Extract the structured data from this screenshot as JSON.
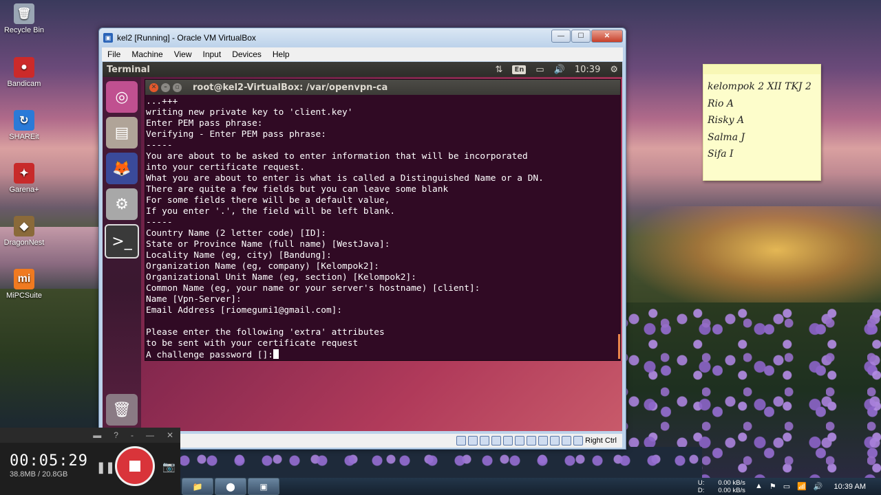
{
  "desktop": {
    "icons": [
      {
        "label": "Recycle Bin",
        "icon": "recycle-bin-icon",
        "glyph": "🗑",
        "color": "#9aa6b4"
      },
      {
        "label": "Bandicam",
        "icon": "bandicam-icon",
        "glyph": "●",
        "color": "#cc2a2a"
      },
      {
        "label": "SHAREit",
        "icon": "shareit-icon",
        "glyph": "↻",
        "color": "#2a7ad8"
      },
      {
        "label": "Garena+",
        "icon": "garena-icon",
        "glyph": "✦",
        "color": "#c82a2a"
      },
      {
        "label": "DragonNest",
        "icon": "dragonnest-icon",
        "glyph": "◆",
        "color": "#8a6a3a"
      },
      {
        "label": "MiPCSuite",
        "icon": "mipcsuite-icon",
        "glyph": "mi",
        "color": "#f07a20"
      }
    ]
  },
  "vbox": {
    "title": "kel2 [Running] - Oracle VM VirtualBox",
    "menu": [
      "File",
      "Machine",
      "View",
      "Input",
      "Devices",
      "Help"
    ],
    "status_host_key": "Right Ctrl"
  },
  "ubuntu": {
    "panel_title": "Terminal",
    "keyboard": "En",
    "clock": "10:39"
  },
  "terminal": {
    "title": "root@kel2-VirtualBox: /var/openvpn-ca",
    "lines": [
      "...+++",
      "writing new private key to 'client.key'",
      "Enter PEM pass phrase:",
      "Verifying - Enter PEM pass phrase:",
      "-----",
      "You are about to be asked to enter information that will be incorporated",
      "into your certificate request.",
      "What you are about to enter is what is called a Distinguished Name or a DN.",
      "There are quite a few fields but you can leave some blank",
      "For some fields there will be a default value,",
      "If you enter '.', the field will be left blank.",
      "-----",
      "Country Name (2 letter code) [ID]:",
      "State or Province Name (full name) [WestJava]:",
      "Locality Name (eg, city) [Bandung]:",
      "Organization Name (eg, company) [Kelompok2]:",
      "Organizational Unit Name (eg, section) [Kelompok2]:",
      "Common Name (eg, your name or your server's hostname) [client]:",
      "Name [Vpn-Server]:",
      "Email Address [riomegumi1@gmail.com]:",
      "",
      "Please enter the following 'extra' attributes",
      "to be sent with your certificate request"
    ],
    "prompt_line": "A challenge password []:"
  },
  "sticky": {
    "lines": [
      "kelompok 2 XII TKJ 2",
      "Rio A",
      "Risky A",
      "Salma J",
      "Sifa I"
    ]
  },
  "bandicam": {
    "elapsed": "00:05:29",
    "size": "38.8MB / 20.8GB"
  },
  "taskbar": {
    "net_up": "U:",
    "net_down": "D:",
    "up_rate": "0.00 kB/s",
    "down_rate": "0.00 kB/s",
    "clock": "10:39 AM"
  }
}
